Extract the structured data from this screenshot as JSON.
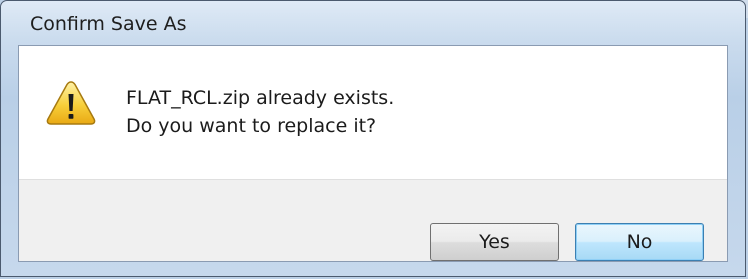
{
  "window": {
    "title": "Confirm Save As"
  },
  "message": {
    "line1": "FLAT_RCL.zip already exists.",
    "line2": "Do you want to replace it?"
  },
  "buttons": {
    "yes_label": "Yes",
    "no_label": "No"
  },
  "icons": {
    "warning": "warning-icon"
  },
  "colors": {
    "titlebar": "#c9dbee",
    "dialog_body": "#ffffff",
    "footer": "#f0f0f0",
    "default_button_border": "#3c7fb1",
    "warning_yellow": "#f6c531"
  }
}
